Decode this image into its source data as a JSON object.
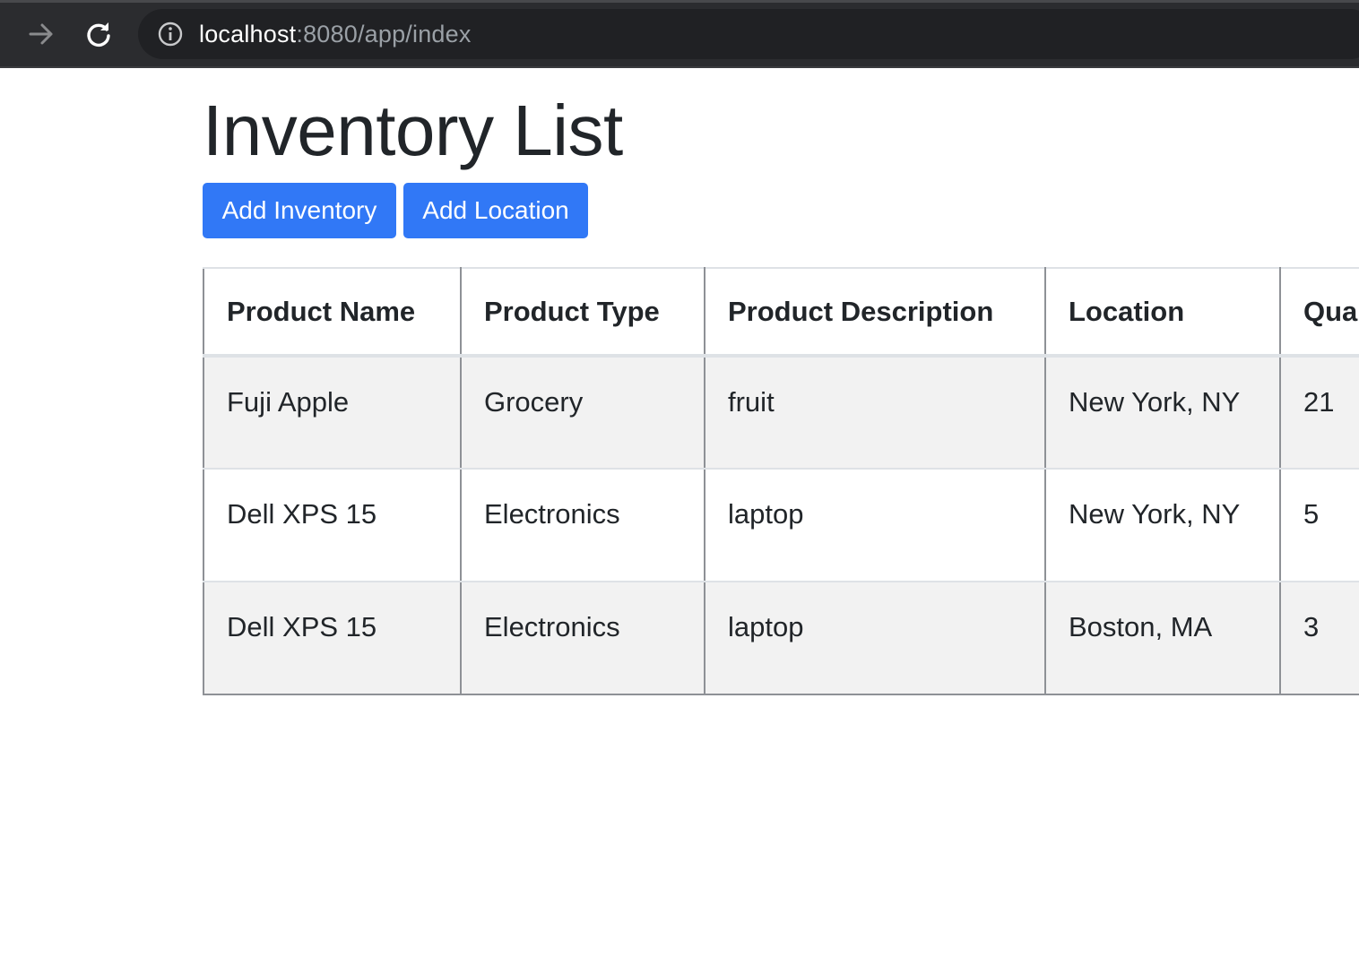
{
  "browser": {
    "url_host": "localhost",
    "url_path": ":8080/app/index",
    "icons": {
      "forward": "arrow-right-icon",
      "reload": "reload-icon",
      "site_info": "info-icon"
    }
  },
  "page": {
    "title": "Inventory List",
    "buttons": {
      "add_inventory": "Add Inventory",
      "add_location": "Add Location"
    },
    "accent_color": "#3178f6"
  },
  "table": {
    "headers": [
      "Product Name",
      "Product Type",
      "Product Description",
      "Location",
      "Qua"
    ],
    "rows": [
      [
        "Fuji Apple",
        "Grocery",
        "fruit",
        "New York, NY",
        "21"
      ],
      [
        "Dell XPS 15",
        "Electronics",
        "laptop",
        "New York, NY",
        "5"
      ],
      [
        "Dell XPS 15",
        "Electronics",
        "laptop",
        "Boston, MA",
        "3"
      ]
    ]
  }
}
